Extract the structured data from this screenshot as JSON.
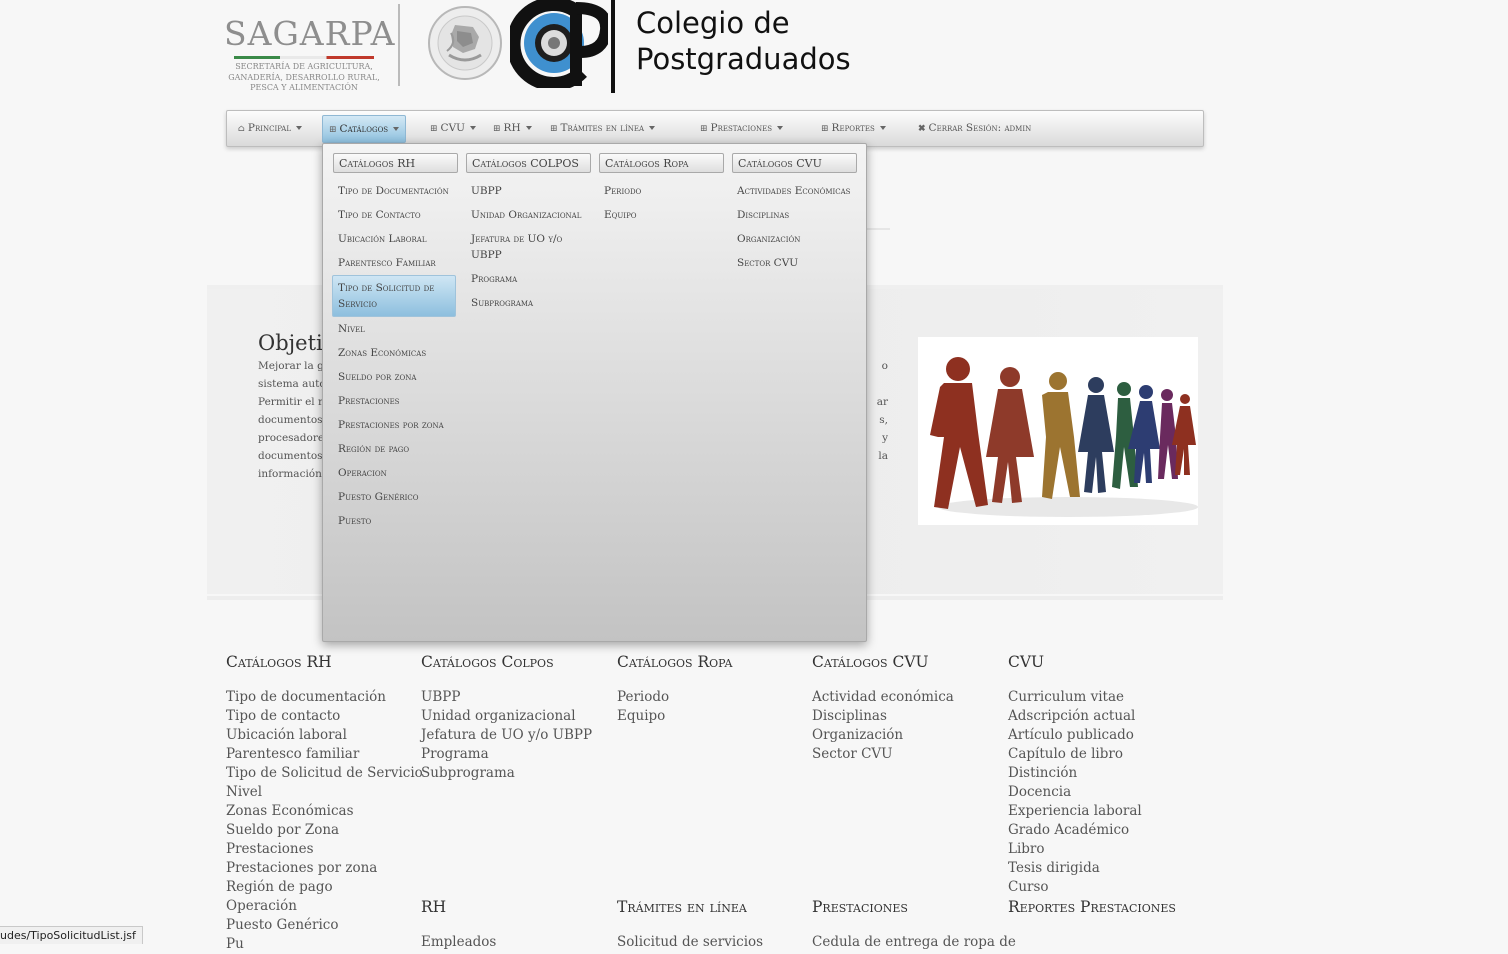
{
  "header": {
    "sagarpa_name": "SAGARPA",
    "sagarpa_sub": [
      "Secretaría de Agricultura,",
      "Ganadería, Desarrollo Rural,",
      "Pesca y Alimentación"
    ],
    "seal_text": "ESTADOS UNIDOS MEXICANOS",
    "institution_lines": [
      "Colegio de",
      "Postgraduados"
    ]
  },
  "nav": [
    {
      "label": "Principal",
      "icon": "home-icon",
      "has_caret": true
    },
    {
      "label": "Catálogos",
      "icon": "grid-icon",
      "has_caret": true,
      "active": true
    },
    {
      "label": "CVU",
      "icon": "grid-icon",
      "has_caret": true
    },
    {
      "label": "RH",
      "icon": "grid-icon",
      "has_caret": true
    },
    {
      "label": "Trámites en línea",
      "icon": "grid-icon",
      "has_caret": true
    },
    {
      "label": "Prestaciones",
      "icon": "grid-icon",
      "has_caret": true
    },
    {
      "label": "Reportes",
      "icon": "grid-icon",
      "has_caret": true
    },
    {
      "label": "Cerrar Sesión: admin",
      "icon": "close-icon",
      "has_caret": false
    }
  ],
  "dropdown": {
    "columns": [
      {
        "header": "Catálogos RH",
        "items": [
          "Tipo de Documentación",
          "Tipo de Contacto",
          "Ubicación Laboral",
          "Parentesco Familiar",
          "Tipo de Solicitud de Servicio",
          "Nivel",
          "Zonas Económicas",
          "Sueldo por zona",
          "Prestaciones",
          "Prestaciones por zona",
          "Región de pago",
          "Operacion",
          "Puesto Genérico",
          "Puesto"
        ],
        "selected_index": 4
      },
      {
        "header": "Catálogos COLPOS",
        "items": [
          "UBPP",
          "Unidad Organizacional",
          "Jefatura de UO y/o UBPP",
          "Programa",
          "Subprograma"
        ]
      },
      {
        "header": "Catálogos Ropa",
        "items": [
          "Periodo",
          "Equipo"
        ]
      },
      {
        "header": "Catálogos CVU",
        "items": [
          "Actividades Económicas",
          "Disciplinas",
          "Organización",
          "Sector CVU"
        ]
      }
    ]
  },
  "main": {
    "objective_title": "Objetiv",
    "objective_left_lines": [
      "Mejorar la g",
      "sistema autor",
      "Permitir el r",
      "documentos",
      "procesadores",
      "documentos",
      "información."
    ],
    "objective_right_lines": [
      "o",
      "",
      "ar",
      "s,",
      "y",
      "la",
      ""
    ],
    "image_alt": "people-holding-hands"
  },
  "footer": {
    "columns": [
      {
        "title": "Catálogos RH",
        "links": [
          "Tipo de documentación",
          "Tipo de contacto",
          "Ubicación laboral",
          "Parentesco familiar",
          "Tipo de Solicitud de Servicio",
          "Nivel",
          "Zonas Económicas",
          "Sueldo por Zona",
          "Prestaciones",
          "Prestaciones por zona",
          "Región de pago",
          "Operación",
          "Puesto Genérico",
          "Pu"
        ]
      },
      {
        "title": "Catálogos Colpos",
        "links": [
          "UBPP",
          "Unidad organizacional",
          "Jefatura de UO y/o UBPP",
          "Programa",
          "Subprograma"
        ]
      },
      {
        "title": "Catálogos Ropa",
        "links": [
          "Periodo",
          "Equipo"
        ]
      },
      {
        "title": "Catálogos CVU",
        "links": [
          "Actividad económica",
          "Disciplinas",
          "Organización",
          "Sector CVU"
        ]
      },
      {
        "title": "CVU",
        "links": [
          "Curriculum vitae",
          "Adscripción actual",
          "Artículo publicado",
          "Capítulo de libro",
          "Distinción",
          "Docencia",
          "Experiencia laboral",
          "Grado Académico",
          "Libro",
          "Tesis dirigida",
          "Curso"
        ]
      }
    ],
    "second_row": [
      {
        "title": "RH",
        "links": [
          "Empleados"
        ]
      },
      {
        "title": "Trámites en línea",
        "links": [
          "Solicitud de servicios"
        ]
      },
      {
        "title": "Prestaciones",
        "links": [
          "Cedula de entrega de ropa de"
        ]
      },
      {
        "title": "Reportes Prestaciones",
        "links": []
      }
    ]
  },
  "status_bar": {
    "url": "udes/TipoSolicitudList.jsf"
  }
}
